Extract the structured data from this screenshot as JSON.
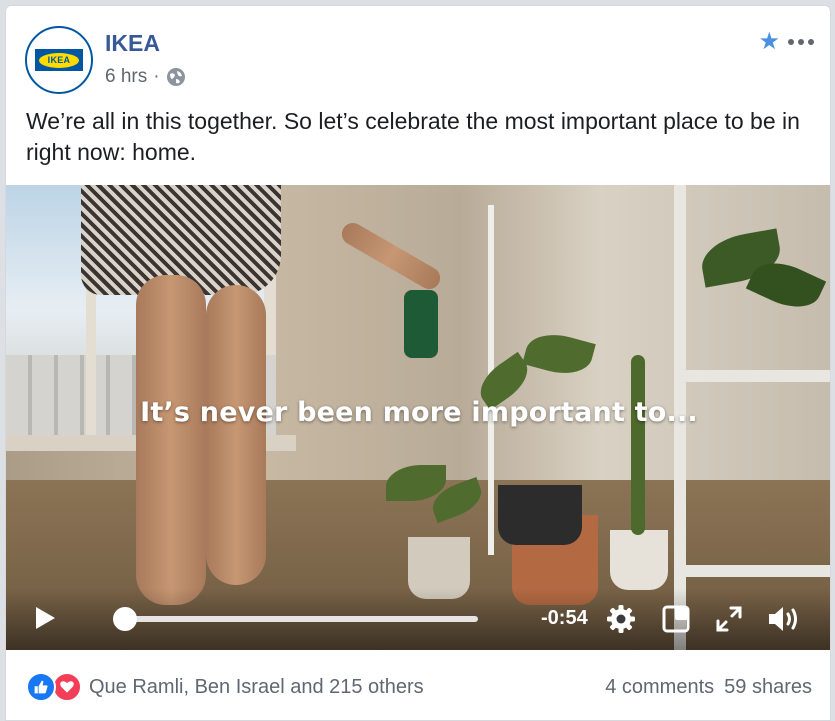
{
  "post": {
    "page_name": "IKEA",
    "logo_text": "IKEA",
    "time": "6 hrs",
    "separator": "·",
    "privacy_icon": "globe-icon",
    "text": "We’re all in this together. So let’s celebrate the most important place to be in right now: home."
  },
  "header_actions": {
    "star_icon": "star-icon",
    "more_icon": "more-options-icon"
  },
  "video": {
    "caption": "It’s never been more important to...",
    "time_remaining": "-0:54",
    "progress": 0.0,
    "controls": [
      "play-icon",
      "settings-gear-icon",
      "picture-in-picture-icon",
      "fullscreen-icon",
      "volume-icon"
    ]
  },
  "footer": {
    "reaction_icons": [
      "like-icon",
      "love-icon"
    ],
    "reactions_text": "Que Ramli, Ben Israel and 215 others",
    "comments": "4 comments",
    "shares": "59 shares"
  },
  "colors": {
    "page_name": "#385898",
    "meta_text": "#606770",
    "like": "#1877f2",
    "love": "#f33e58",
    "star": "#4a90e2",
    "ikea_blue": "#0058a3",
    "ikea_yellow": "#ffdb00"
  }
}
